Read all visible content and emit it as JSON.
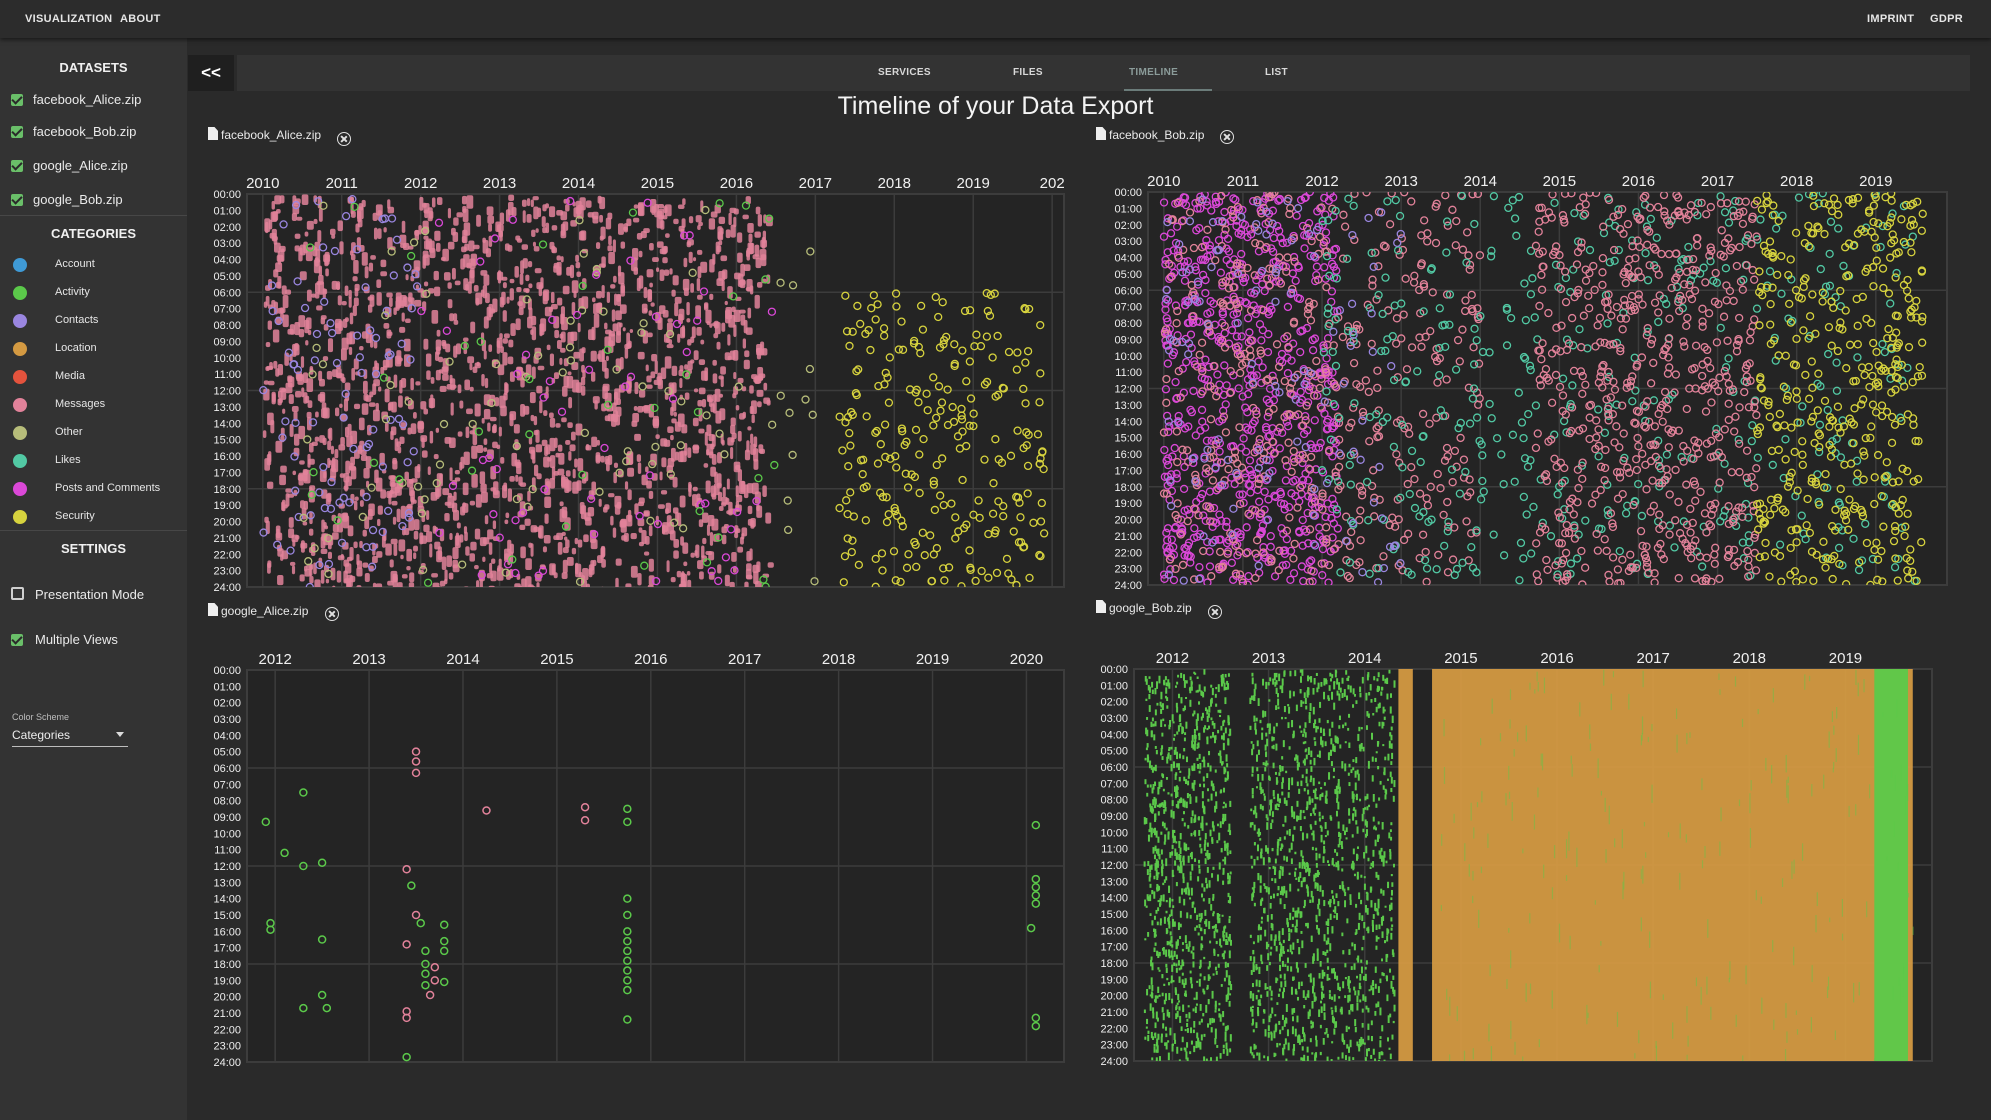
{
  "nav": {
    "visualization": "VISUALIZATION",
    "about": "ABOUT",
    "imprint": "IMPRINT",
    "gdpr": "GDPR"
  },
  "sidebar": {
    "datasets_heading": "DATASETS",
    "datasets": [
      {
        "label": "facebook_Alice.zip",
        "checked": true
      },
      {
        "label": "facebook_Bob.zip",
        "checked": true
      },
      {
        "label": "google_Alice.zip",
        "checked": true
      },
      {
        "label": "google_Bob.zip",
        "checked": true
      }
    ],
    "categories_heading": "CATEGORIES",
    "categories": [
      {
        "label": "Account",
        "color": "#3f9ad6"
      },
      {
        "label": "Activity",
        "color": "#5bc94a"
      },
      {
        "label": "Contacts",
        "color": "#9a86e0"
      },
      {
        "label": "Location",
        "color": "#d49a42"
      },
      {
        "label": "Media",
        "color": "#e4533d"
      },
      {
        "label": "Messages",
        "color": "#e2829a"
      },
      {
        "label": "Other",
        "color": "#b7bd7a"
      },
      {
        "label": "Likes",
        "color": "#52c9a4"
      },
      {
        "label": "Posts and Comments",
        "color": "#db48d8"
      },
      {
        "label": "Security",
        "color": "#d7d33e"
      }
    ],
    "settings_heading": "SETTINGS",
    "presentation_mode": {
      "label": "Presentation Mode",
      "checked": false
    },
    "multiple_views": {
      "label": "Multiple Views",
      "checked": true
    },
    "color_scheme": {
      "label": "Color Scheme",
      "value": "Categories"
    }
  },
  "toolbar": {
    "collapse_label": "<<"
  },
  "tabs": [
    {
      "label": "SERVICES",
      "active": false
    },
    {
      "label": "FILES",
      "active": false
    },
    {
      "label": "TIMELINE",
      "active": true
    },
    {
      "label": "LIST",
      "active": false
    }
  ],
  "page_title": "Timeline of your Data Export",
  "hours": [
    "00:00",
    "01:00",
    "02:00",
    "03:00",
    "04:00",
    "05:00",
    "06:00",
    "07:00",
    "08:00",
    "09:00",
    "10:00",
    "11:00",
    "12:00",
    "13:00",
    "14:00",
    "15:00",
    "16:00",
    "17:00",
    "18:00",
    "19:00",
    "20:00",
    "21:00",
    "22:00",
    "23:00",
    "24:00"
  ],
  "panels": [
    {
      "title": "facebook_Alice.zip",
      "years": [
        "2010",
        "2011",
        "2012",
        "2013",
        "2014",
        "2015",
        "2016",
        "2017",
        "2018",
        "2019",
        "202"
      ]
    },
    {
      "title": "facebook_Bob.zip",
      "years": [
        "2010",
        "2011",
        "2012",
        "2013",
        "2014",
        "2015",
        "2016",
        "2017",
        "2018",
        "2019"
      ]
    },
    {
      "title": "google_Alice.zip",
      "years": [
        "2012",
        "2013",
        "2014",
        "2015",
        "2016",
        "2017",
        "2018",
        "2019",
        "2020"
      ]
    },
    {
      "title": "google_Bob.zip",
      "years": [
        "2012",
        "2013",
        "2014",
        "2015",
        "2016",
        "2017",
        "2018",
        "2019"
      ]
    }
  ],
  "chart_data": [
    {
      "type": "scatter",
      "title": "facebook_Alice.zip",
      "x_axis": "year",
      "y_axis": "time of day",
      "xlim": [
        "2010",
        "2020"
      ],
      "ylim": [
        "00:00",
        "24:00"
      ],
      "density": [
        {
          "category": "Messages",
          "color": "#e2829a",
          "x_range": [
            2010.0,
            2016.4
          ],
          "y_range": [
            0,
            24
          ],
          "count": 1800,
          "filled": true
        },
        {
          "category": "Contacts",
          "color": "#9a86e0",
          "x_range": [
            2010.0,
            2012.0
          ],
          "y_range": [
            0,
            24
          ],
          "count": 90
        },
        {
          "category": "Other",
          "color": "#b7bd7a",
          "x_range": [
            2010.5,
            2017.0
          ],
          "y_range": [
            0,
            24
          ],
          "count": 90
        },
        {
          "category": "Posts and Comments",
          "color": "#db48d8",
          "x_range": [
            2012.0,
            2016.5
          ],
          "y_range": [
            0,
            24
          ],
          "count": 60
        },
        {
          "category": "Security",
          "color": "#d7d33e",
          "x_range": [
            2017.3,
            2019.9
          ],
          "y_range": [
            6,
            24
          ],
          "count": 260
        },
        {
          "category": "Activity",
          "color": "#5bc94a",
          "x_range": [
            2010.5,
            2016.5
          ],
          "y_range": [
            0,
            24
          ],
          "count": 40
        }
      ]
    },
    {
      "type": "scatter",
      "title": "facebook_Bob.zip",
      "x_axis": "year",
      "y_axis": "time of day",
      "xlim": [
        "2010",
        "2019"
      ],
      "ylim": [
        "00:00",
        "24:00"
      ],
      "density": [
        {
          "category": "Posts and Comments",
          "color": "#db48d8",
          "x_range": [
            2010.0,
            2012.2
          ],
          "y_range": [
            0,
            24
          ],
          "count": 700
        },
        {
          "category": "Messages",
          "color": "#e2829a",
          "x_range": [
            2010.0,
            2014.0
          ],
          "y_range": [
            0,
            24
          ],
          "count": 500
        },
        {
          "category": "Likes",
          "color": "#52c9a4",
          "x_range": [
            2012.0,
            2019.5
          ],
          "y_range": [
            0,
            24
          ],
          "count": 450
        },
        {
          "category": "Messages",
          "color": "#e2829a",
          "x_range": [
            2014.7,
            2017.5
          ],
          "y_range": [
            0,
            24
          ],
          "count": 600
        },
        {
          "category": "Security",
          "color": "#d7d33e",
          "x_range": [
            2017.5,
            2019.6
          ],
          "y_range": [
            0,
            24
          ],
          "count": 400
        },
        {
          "category": "Contacts",
          "color": "#9a86e0",
          "x_range": [
            2010.0,
            2013.0
          ],
          "y_range": [
            0,
            24
          ],
          "count": 120
        }
      ]
    },
    {
      "type": "scatter",
      "title": "google_Alice.zip",
      "x_axis": "year",
      "y_axis": "time of day",
      "xlim": [
        "2012",
        "2020"
      ],
      "ylim": [
        "00:00",
        "24:00"
      ],
      "points": [
        {
          "year": 2011.9,
          "hour": 9.3,
          "category": "Activity"
        },
        {
          "year": 2011.95,
          "hour": 15.5,
          "category": "Activity"
        },
        {
          "year": 2011.95,
          "hour": 15.9,
          "category": "Activity"
        },
        {
          "year": 2012.1,
          "hour": 11.2,
          "category": "Activity"
        },
        {
          "year": 2012.3,
          "hour": 7.5,
          "category": "Activity"
        },
        {
          "year": 2012.3,
          "hour": 12.0,
          "category": "Activity"
        },
        {
          "year": 2012.3,
          "hour": 20.7,
          "category": "Activity"
        },
        {
          "year": 2012.5,
          "hour": 11.8,
          "category": "Activity"
        },
        {
          "year": 2012.5,
          "hour": 16.5,
          "category": "Activity"
        },
        {
          "year": 2012.5,
          "hour": 19.9,
          "category": "Activity"
        },
        {
          "year": 2012.55,
          "hour": 20.7,
          "category": "Activity"
        },
        {
          "year": 2013.4,
          "hour": 12.2,
          "category": "Messages"
        },
        {
          "year": 2013.4,
          "hour": 16.8,
          "category": "Messages"
        },
        {
          "year": 2013.4,
          "hour": 20.9,
          "category": "Messages"
        },
        {
          "year": 2013.4,
          "hour": 21.3,
          "category": "Messages"
        },
        {
          "year": 2013.4,
          "hour": 23.7,
          "category": "Activity"
        },
        {
          "year": 2013.45,
          "hour": 13.2,
          "category": "Activity"
        },
        {
          "year": 2013.5,
          "hour": 5.0,
          "category": "Messages"
        },
        {
          "year": 2013.5,
          "hour": 5.6,
          "category": "Messages"
        },
        {
          "year": 2013.5,
          "hour": 6.3,
          "category": "Messages"
        },
        {
          "year": 2013.5,
          "hour": 15.0,
          "category": "Messages"
        },
        {
          "year": 2013.55,
          "hour": 15.5,
          "category": "Activity"
        },
        {
          "year": 2013.6,
          "hour": 17.2,
          "category": "Activity"
        },
        {
          "year": 2013.6,
          "hour": 18.0,
          "category": "Activity"
        },
        {
          "year": 2013.6,
          "hour": 18.6,
          "category": "Activity"
        },
        {
          "year": 2013.6,
          "hour": 19.3,
          "category": "Activity"
        },
        {
          "year": 2013.65,
          "hour": 19.9,
          "category": "Messages"
        },
        {
          "year": 2013.7,
          "hour": 18.2,
          "category": "Messages"
        },
        {
          "year": 2013.7,
          "hour": 19.0,
          "category": "Messages"
        },
        {
          "year": 2013.8,
          "hour": 15.6,
          "category": "Activity"
        },
        {
          "year": 2013.8,
          "hour": 16.6,
          "category": "Activity"
        },
        {
          "year": 2013.8,
          "hour": 17.2,
          "category": "Activity"
        },
        {
          "year": 2013.8,
          "hour": 19.1,
          "category": "Activity"
        },
        {
          "year": 2014.25,
          "hour": 8.6,
          "category": "Messages"
        },
        {
          "year": 2015.3,
          "hour": 8.4,
          "category": "Messages"
        },
        {
          "year": 2015.3,
          "hour": 9.2,
          "category": "Messages"
        },
        {
          "year": 2015.75,
          "hour": 8.5,
          "category": "Activity"
        },
        {
          "year": 2015.75,
          "hour": 9.3,
          "category": "Activity"
        },
        {
          "year": 2015.75,
          "hour": 14.0,
          "category": "Activity"
        },
        {
          "year": 2015.75,
          "hour": 15.0,
          "category": "Activity"
        },
        {
          "year": 2015.75,
          "hour": 16.0,
          "category": "Activity"
        },
        {
          "year": 2015.75,
          "hour": 16.6,
          "category": "Activity"
        },
        {
          "year": 2015.75,
          "hour": 17.2,
          "category": "Activity"
        },
        {
          "year": 2015.75,
          "hour": 17.8,
          "category": "Activity"
        },
        {
          "year": 2015.75,
          "hour": 18.4,
          "category": "Activity"
        },
        {
          "year": 2015.75,
          "hour": 19.0,
          "category": "Activity"
        },
        {
          "year": 2015.75,
          "hour": 19.6,
          "category": "Activity"
        },
        {
          "year": 2015.75,
          "hour": 21.4,
          "category": "Activity"
        },
        {
          "year": 2020.1,
          "hour": 9.5,
          "category": "Activity"
        },
        {
          "year": 2020.1,
          "hour": 12.8,
          "category": "Activity"
        },
        {
          "year": 2020.1,
          "hour": 13.3,
          "category": "Activity"
        },
        {
          "year": 2020.1,
          "hour": 13.8,
          "category": "Activity"
        },
        {
          "year": 2020.1,
          "hour": 14.3,
          "category": "Activity"
        },
        {
          "year": 2020.05,
          "hour": 15.8,
          "category": "Activity"
        },
        {
          "year": 2020.1,
          "hour": 21.3,
          "category": "Activity"
        },
        {
          "year": 2020.1,
          "hour": 21.8,
          "category": "Activity"
        }
      ]
    },
    {
      "type": "scatter",
      "title": "google_Bob.zip",
      "x_axis": "year",
      "y_axis": "time of day",
      "xlim": [
        "2012",
        "2019"
      ],
      "ylim": [
        "00:00",
        "24:00"
      ],
      "density": [
        {
          "category": "Activity",
          "color": "#5bc94a",
          "x_range": [
            2011.7,
            2012.6
          ],
          "y_range": [
            0,
            24
          ],
          "count": 900
        },
        {
          "category": "Activity",
          "color": "#5bc94a",
          "x_range": [
            2012.8,
            2014.3
          ],
          "y_range": [
            0,
            24
          ],
          "count": 1200
        }
      ],
      "bands": [
        {
          "category": "Location",
          "color": "#d49a42",
          "x_range": [
            2014.35,
            2014.5
          ]
        },
        {
          "category": "Location",
          "color": "#d49a42",
          "x_range": [
            2014.7,
            2019.7
          ]
        },
        {
          "category": "Activity",
          "color": "#5bc94a",
          "x_range": [
            2019.3,
            2019.65
          ]
        }
      ]
    }
  ]
}
